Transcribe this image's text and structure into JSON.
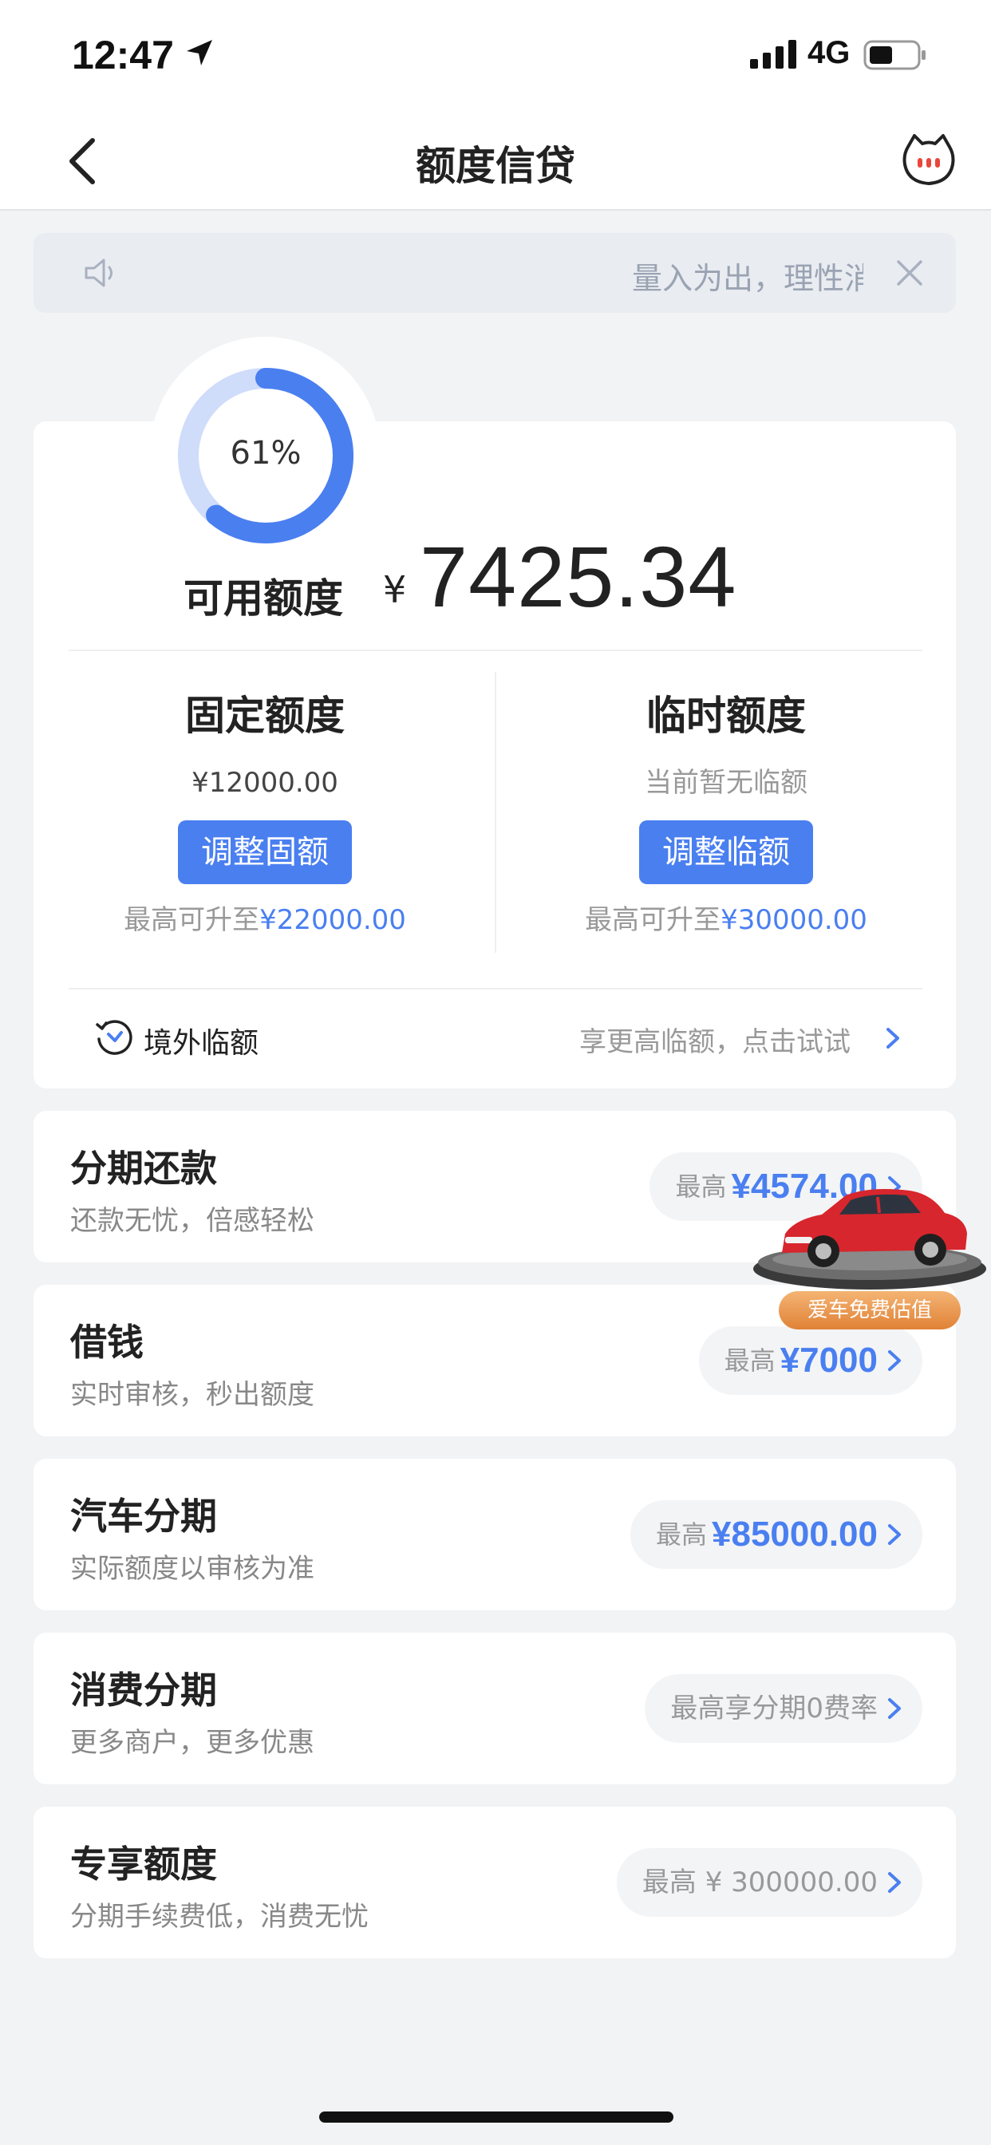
{
  "status_bar": {
    "time": "12:47",
    "network": "4G"
  },
  "nav": {
    "title": "额度信贷"
  },
  "notice": {
    "text": "量入为出，理性消费"
  },
  "credit": {
    "usage_percent_label": "61%",
    "usage_fraction": 0.61,
    "available_label": "可用额度",
    "currency": "¥",
    "available_amount": "7425.34",
    "fixed": {
      "title": "固定额度",
      "value": "¥12000.00",
      "button": "调整固额",
      "note_prefix": "最高可升至",
      "note_amount": "¥22000.00"
    },
    "temporary": {
      "title": "临时额度",
      "value": "当前暂无临额",
      "button": "调整临额",
      "note_prefix": "最高可升至",
      "note_amount": "¥30000.00"
    },
    "overseas": {
      "label": "境外临额",
      "hint": "享更高临额，点击试试"
    }
  },
  "products": [
    {
      "title": "分期还款",
      "subtitle": "还款无忧，倍感轻松",
      "prefix": "最高",
      "amount": "¥4574.00"
    },
    {
      "title": "借钱",
      "subtitle": "实时审核，秒出额度",
      "prefix": "最高",
      "amount": "¥7000"
    },
    {
      "title": "汽车分期",
      "subtitle": "实际额度以审核为准",
      "prefix": "最高",
      "amount": "¥85000.00"
    },
    {
      "title": "消费分期",
      "subtitle": "更多商户，更多优惠",
      "text": "最高享分期0费率"
    },
    {
      "title": "专享额度",
      "subtitle": "分期手续费低，消费无忧",
      "text": "最高 ¥ 300000.00"
    }
  ],
  "floating_ad": {
    "label": "爱车免费估值"
  },
  "colors": {
    "accent": "#4a7ff0",
    "ring_track": "#cfdcfa",
    "background": "#f2f3f5"
  }
}
